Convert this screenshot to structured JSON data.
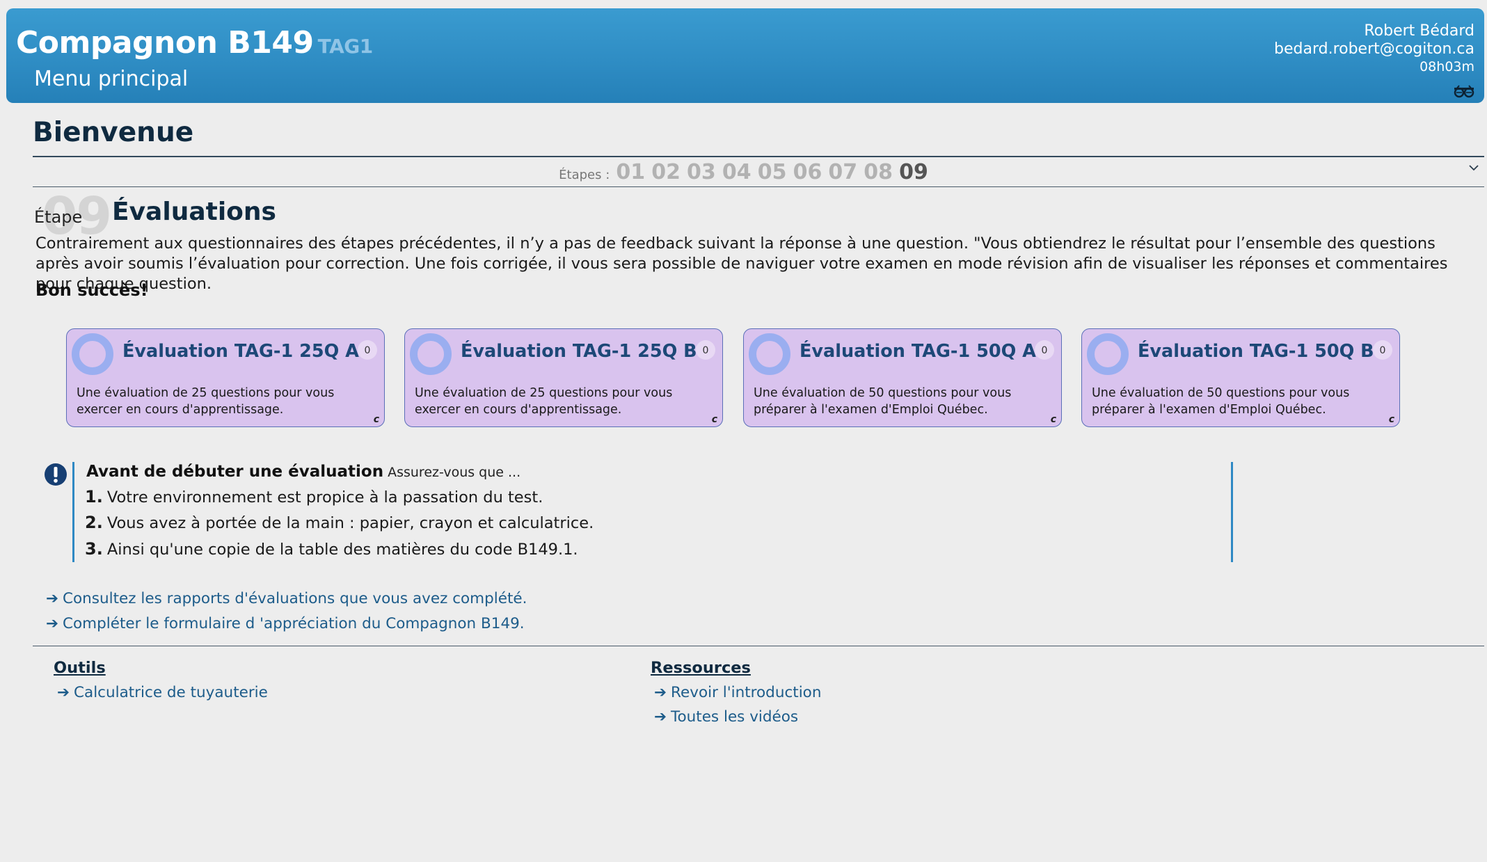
{
  "header": {
    "title": "Compagnon B149",
    "tag": "TAG1",
    "subtitle": "Menu principal",
    "user_name": "Robert Bédard",
    "user_email": "bedard.robert@cogiton.ca",
    "time": "08h03m",
    "icon": "glasses-icon",
    "colors": {
      "header_bg": "#3a9bd0",
      "header_text": "#ffffff"
    }
  },
  "welcome": "Bienvenue",
  "steps": {
    "label": "Étapes :",
    "items": [
      "01",
      "02",
      "03",
      "04",
      "05",
      "06",
      "07",
      "08",
      "09"
    ],
    "active": "09"
  },
  "stage": {
    "number": "09",
    "label": "Étape",
    "title": "Évaluations",
    "description": "Contrairement aux questionnaires des étapes précédentes, il n’y a pas de feedback suivant la réponse à une question. \"Vous obtiendrez le résultat pour l’ensemble des questions après avoir soumis l’évaluation pour correction. Une fois corrigée, il vous sera possible de naviguer votre examen en mode révision afin de visualiser les réponses et commentaires pour chaque question.",
    "good_luck": "Bon succès!"
  },
  "cards": [
    {
      "title": "Évaluation TAG-1 25Q A",
      "count": "0",
      "description": "Une évaluation de 25 questions pour vous exercer en cours d'apprentissage.",
      "corner": "c"
    },
    {
      "title": "Évaluation TAG-1 25Q B",
      "count": "0",
      "description": "Une évaluation de 25 questions pour vous exercer en cours d'apprentissage.",
      "corner": "c"
    },
    {
      "title": "Évaluation TAG-1 50Q A",
      "count": "0",
      "description": "Une évaluation de 50 questions pour vous préparer à l'examen d'Emploi Québec.",
      "corner": "c"
    },
    {
      "title": "Évaluation TAG-1 50Q B",
      "count": "0",
      "description": "Une évaluation de 50 questions pour vous préparer à l'examen d'Emploi Québec.",
      "corner": "c"
    }
  ],
  "notice": {
    "title": "Avant de débuter une évaluation",
    "subtitle": "Assurez-vous que ...",
    "items": [
      {
        "num": "1.",
        "text": "Votre environnement est propice à la passation du test."
      },
      {
        "num": "2.",
        "text": "Vous avez à portée de la main : papier, crayon et calculatrice."
      },
      {
        "num": "3.",
        "text": "Ainsi qu'une copie de la table des matières du code B149.1."
      }
    ]
  },
  "links": {
    "arrow": "➔",
    "reports": "Consultez les rapports d'évaluations que vous avez complété.",
    "feedback": "Compléter le formulaire d 'appréciation du Compagnon B149."
  },
  "tools": {
    "title": "Outils",
    "items": [
      "Calculatrice de tuyauterie"
    ]
  },
  "resources": {
    "title": "Ressources",
    "items": [
      "Revoir l'introduction",
      "Toutes les vidéos"
    ]
  }
}
